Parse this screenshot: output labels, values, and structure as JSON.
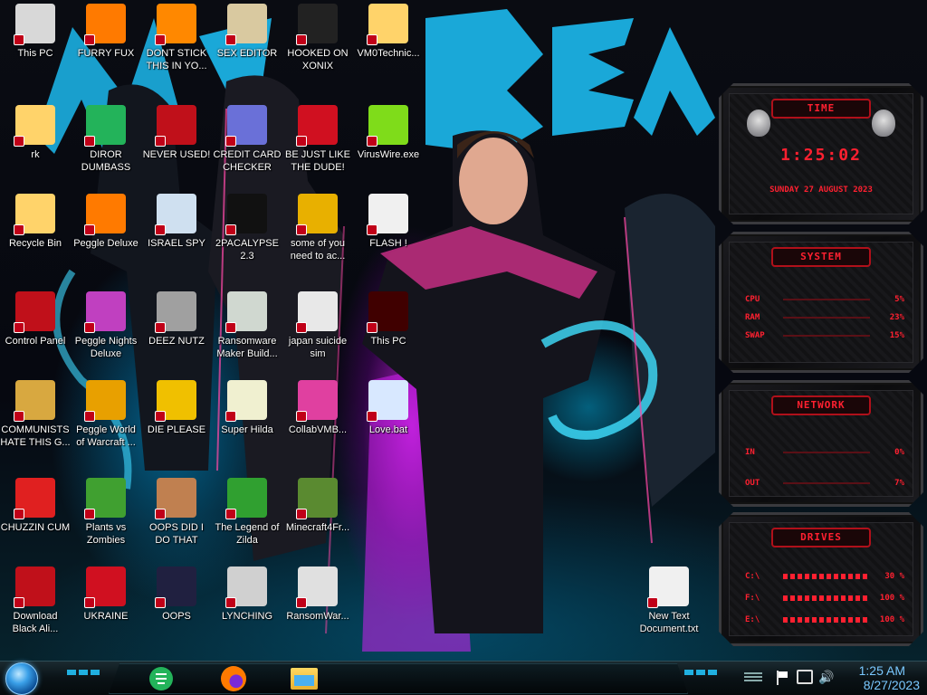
{
  "desktop": {
    "icons": [
      {
        "label": "This PC",
        "icon": "computer-icon",
        "color": "#d8d8d8"
      },
      {
        "label": "FURRY FUX",
        "icon": "firefox-icon",
        "color": "#ff7a00"
      },
      {
        "label": "DONT STICK THIS IN YO...",
        "icon": "vlc-cone-icon",
        "color": "#ff8800"
      },
      {
        "label": "SEX EDITOR",
        "icon": "hex-editor-icon",
        "color": "#d9c9a0"
      },
      {
        "label": "HOOKED ON XONIX",
        "icon": "xonix-game-icon",
        "color": "#222222"
      },
      {
        "label": "VM0Technic...",
        "icon": "cartoon-face-icon",
        "color": "#ffd36a"
      },
      {
        "label": "rk",
        "icon": "cartoon-face-icon",
        "color": "#ffd36a"
      },
      {
        "label": "DIROR DUMBASS",
        "icon": "discord-like-icon",
        "color": "#23b35a"
      },
      {
        "label": "NEVER USED!",
        "icon": "dev-cpp-icon",
        "color": "#c0101a"
      },
      {
        "label": "CREDIT CARD CHECKER",
        "icon": "credit-card-icon",
        "color": "#6a70d8"
      },
      {
        "label": "BE JUST LIKE THE DUDE!",
        "icon": "santa-icon",
        "color": "#d01020"
      },
      {
        "label": "VirusWire.exe",
        "icon": "lime-icon",
        "color": "#7fdc1a"
      },
      {
        "label": "Recycle Bin",
        "icon": "recycle-bin-icon",
        "color": "#ffd36a"
      },
      {
        "label": "Peggle Deluxe",
        "icon": "peggle-icon",
        "color": "#ff7a00"
      },
      {
        "label": "ISRAEL SPY",
        "icon": "network-drive-icon",
        "color": "#cfe0f0"
      },
      {
        "label": "2PACALYPSE 2.3",
        "icon": "terminal-icon",
        "color": "#111111"
      },
      {
        "label": "some of you need to ac...",
        "icon": "dog-icon",
        "color": "#e8b000"
      },
      {
        "label": "FLASH !",
        "icon": "flash-file-icon",
        "color": "#f0f0f0"
      },
      {
        "label": "Control Panel",
        "icon": "control-panel-icon",
        "color": "#c0101a"
      },
      {
        "label": "Peggle Nights Deluxe",
        "icon": "peggle-icon",
        "color": "#c040c0"
      },
      {
        "label": "DEEZ NUTZ",
        "icon": "windows-stack-icon",
        "color": "#a0a0a0"
      },
      {
        "label": "Ransomware Maker Build...",
        "icon": "window-app-icon",
        "color": "#d0d8d0"
      },
      {
        "label": "japan suicide sim",
        "icon": "installer-icon",
        "color": "#e8e8e8"
      },
      {
        "label": "This PC",
        "icon": "red-app-icon",
        "color": "#400000"
      },
      {
        "label": "COMMUNISTS HATE THIS G...",
        "icon": "money-bag-icon",
        "color": "#d8a840"
      },
      {
        "label": "Peggle World of Warcraft ...",
        "icon": "peggle-icon",
        "color": "#e8a000"
      },
      {
        "label": "DIE PLEASE",
        "icon": "de-icon",
        "color": "#f0c000"
      },
      {
        "label": "Super Hilda",
        "icon": "pixel-game-icon",
        "color": "#f0f0d0"
      },
      {
        "label": "CollabVMB...",
        "icon": "monitor-icon",
        "color": "#e040a0"
      },
      {
        "label": "Love.bat",
        "icon": "batch-file-icon",
        "color": "#d8e8ff"
      },
      {
        "label": "CHUZZIN CUM",
        "icon": "chuzzle-icon",
        "color": "#e02020"
      },
      {
        "label": "Plants vs Zombies",
        "icon": "plant-icon",
        "color": "#40a030"
      },
      {
        "label": "OOPS DID I DO THAT",
        "icon": "portrait-icon",
        "color": "#c08050"
      },
      {
        "label": "The Legend of Zilda",
        "icon": "link-sprite-icon",
        "color": "#30a030"
      },
      {
        "label": "Minecraft4Fr...",
        "icon": "minecraft-block-icon",
        "color": "#5a8a30"
      },
      {
        "label": "Download Black Ali...",
        "icon": "alien-orb-icon",
        "color": "#c0101a"
      },
      {
        "label": "UKRAINE",
        "icon": "radiation-icon",
        "color": "#d01020"
      },
      {
        "label": "OOPS",
        "icon": "dark-window-icon",
        "color": "#202040"
      },
      {
        "label": "LYNCHING",
        "icon": "rope-icon",
        "color": "#d0d0d0"
      },
      {
        "label": "RansomWar...",
        "icon": "skull-icon",
        "color": "#e0e0e0"
      },
      {
        "label": "New Text Document.txt",
        "icon": "text-file-icon",
        "color": "#f0f0f0"
      }
    ]
  },
  "gadgets": {
    "time": {
      "title": "TIME",
      "clock": "1:25:02",
      "date": "SUNDAY 27 AUGUST 2023"
    },
    "system": {
      "title": "SYSTEM",
      "rows": [
        {
          "label": "CPU",
          "value": "5%"
        },
        {
          "label": "RAM",
          "value": "23%"
        },
        {
          "label": "SWAP",
          "value": "15%"
        }
      ]
    },
    "network": {
      "title": "NETWORK",
      "rows": [
        {
          "label": "IN",
          "value": "0%"
        },
        {
          "label": "OUT",
          "value": "7%"
        }
      ]
    },
    "drives": {
      "title": "DRIVES",
      "rows": [
        {
          "label": "C:\\",
          "value": "30 %"
        },
        {
          "label": "F:\\",
          "value": "100 %"
        },
        {
          "label": "E:\\",
          "value": "100 %"
        }
      ]
    }
  },
  "taskbar": {
    "pinned": [
      {
        "icon": "chat-app-icon",
        "color": "#23b35a"
      },
      {
        "icon": "firefox-icon",
        "color": "#ff7a00"
      },
      {
        "icon": "file-explorer-icon",
        "color": "#f0c040"
      }
    ],
    "clock": {
      "time": "1:25 AM",
      "date": "8/27/2023"
    }
  },
  "theme": {
    "accent": "#ff2030",
    "taskbar_text": "#7ac8ff"
  }
}
